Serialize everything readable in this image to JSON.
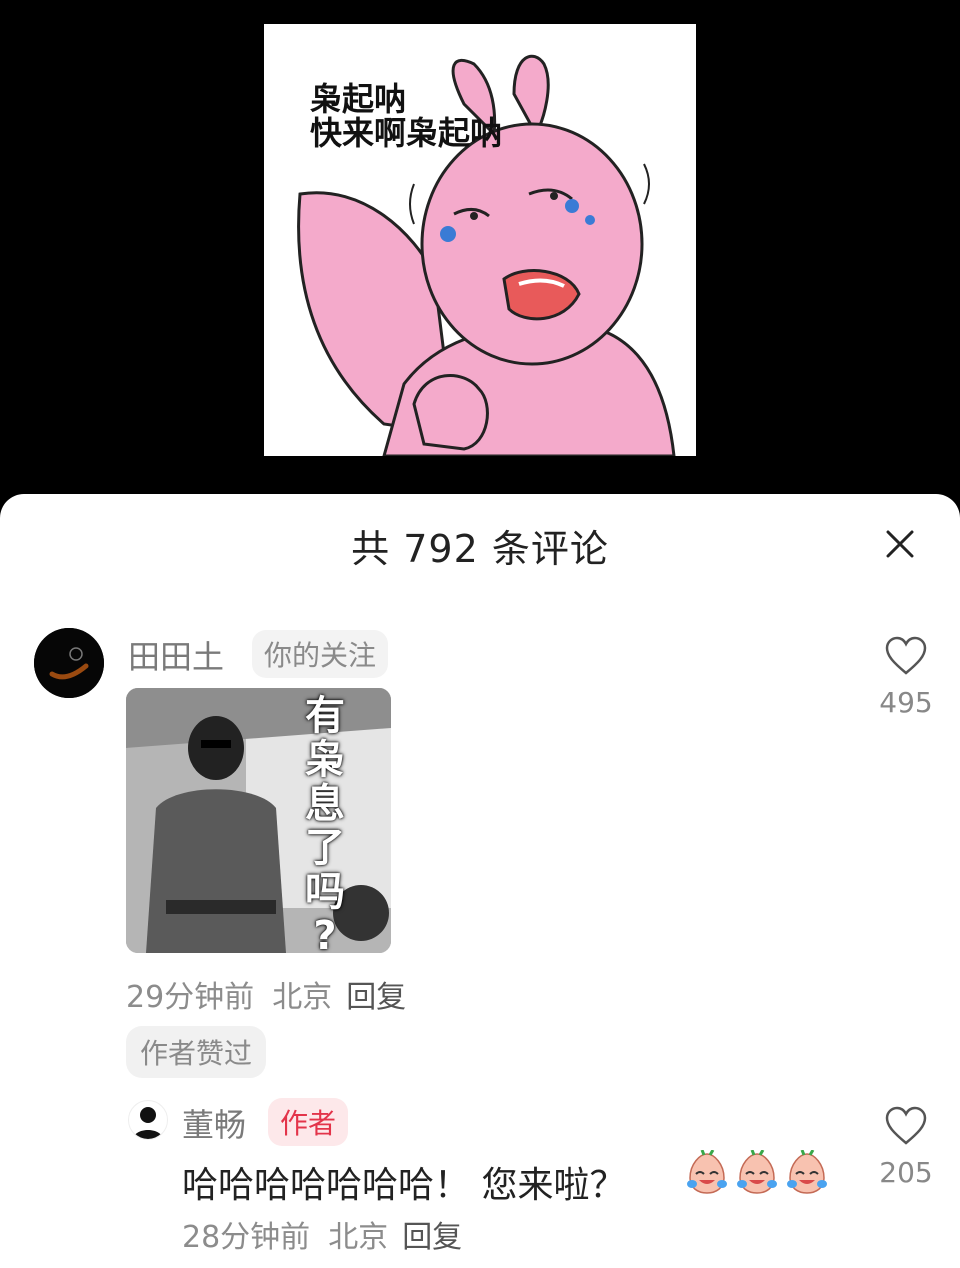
{
  "sticker": {
    "caption": "枭起呐\n快来啊枭起呐"
  },
  "sheet": {
    "title": "共 792 条评论"
  },
  "comments": [
    {
      "username": "田田土",
      "tag": "你的关注",
      "image_caption": [
        "有",
        "枭",
        "息",
        "了",
        "吗",
        "?"
      ],
      "time": "29分钟前",
      "location": "北京",
      "reply_label": "回复",
      "liked_badge": "作者赞过",
      "likes": "495"
    }
  ],
  "reply": {
    "username": "董畅",
    "tag": "作者",
    "text": "哈哈哈哈哈哈哈！ 您来啦？",
    "emojis": [
      "crying-laugh-peach",
      "crying-laugh-peach",
      "crying-laugh-peach"
    ],
    "time": "28分钟前",
    "location": "北京",
    "reply_label": "回复",
    "likes": "205"
  },
  "colors": {
    "author_tag": "#e3344a",
    "sticker_pink": "#f4aacb"
  }
}
